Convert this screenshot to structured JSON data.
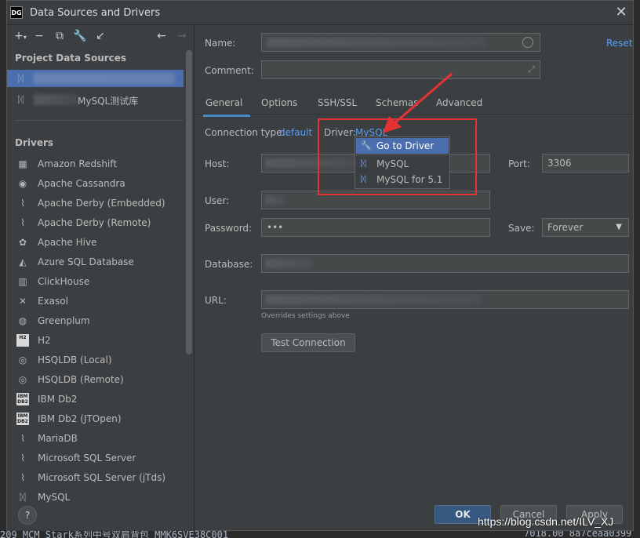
{
  "window": {
    "title": "Data Sources and Drivers",
    "app_icon_text": "DG"
  },
  "left": {
    "project_title": "Project Data Sources",
    "project_items": [
      {
        "label": ""
      },
      {
        "label": "MySQL测试库"
      }
    ],
    "drivers_title": "Drivers",
    "drivers": [
      {
        "label": "Amazon Redshift",
        "icon": "redshift-icon"
      },
      {
        "label": "Apache Cassandra",
        "icon": "cassandra-icon"
      },
      {
        "label": "Apache Derby (Embedded)",
        "icon": "derby-icon"
      },
      {
        "label": "Apache Derby (Remote)",
        "icon": "derby-icon"
      },
      {
        "label": "Apache Hive",
        "icon": "hive-icon"
      },
      {
        "label": "Azure SQL Database",
        "icon": "azure-icon"
      },
      {
        "label": "ClickHouse",
        "icon": "clickhouse-icon"
      },
      {
        "label": "Exasol",
        "icon": "exasol-icon"
      },
      {
        "label": "Greenplum",
        "icon": "greenplum-icon"
      },
      {
        "label": "H2",
        "icon": "h2-icon",
        "badge": "H2"
      },
      {
        "label": "HSQLDB (Local)",
        "icon": "hsqldb-icon"
      },
      {
        "label": "HSQLDB (Remote)",
        "icon": "hsqldb-icon"
      },
      {
        "label": "IBM Db2",
        "icon": "ibm-db2-icon",
        "badge": "IBM DB2"
      },
      {
        "label": "IBM Db2 (JTOpen)",
        "icon": "ibm-db2-icon",
        "badge": "IBM DB2"
      },
      {
        "label": "MariaDB",
        "icon": "mariadb-icon"
      },
      {
        "label": "Microsoft SQL Server",
        "icon": "mssql-icon"
      },
      {
        "label": "Microsoft SQL Server (jTds)",
        "icon": "mssql-icon"
      },
      {
        "label": "MySQL",
        "icon": "mysql-icon"
      }
    ],
    "help_label": "?"
  },
  "form": {
    "name_label": "Name:",
    "name_value": "",
    "reset_label": "Reset",
    "comment_label": "Comment:",
    "comment_value": "",
    "tabs": [
      "General",
      "Options",
      "SSH/SSL",
      "Schemas",
      "Advanced"
    ],
    "active_tab": "General",
    "connection_type_label": "Connection type:",
    "connection_type_value": "default",
    "driver_label": "Driver:",
    "driver_value": "MySQL",
    "host_label": "Host:",
    "host_value": "",
    "port_label": "Port:",
    "port_value": "3306",
    "user_label": "User:",
    "user_value": "",
    "password_label": "Password:",
    "password_value": "•••",
    "save_label": "Save:",
    "save_value": "Forever",
    "database_label": "Database:",
    "database_value": "",
    "url_label": "URL:",
    "url_value": "",
    "url_hint": "Overrides settings above",
    "test_connection_label": "Test Connection"
  },
  "driver_popup": {
    "items": [
      {
        "label": "Go to Driver",
        "icon": "wrench-icon"
      },
      {
        "label": "MySQL",
        "icon": "mysql-icon"
      },
      {
        "label": "MySQL for 5.1",
        "icon": "mysql-icon"
      }
    ]
  },
  "buttons": {
    "ok": "OK",
    "cancel": "Cancel",
    "apply": "Apply"
  },
  "background": {
    "bottom_text": "209  MCM Stark系列中号双肩背包 MMK6SVE38C001",
    "bottom_right": "7018.00  8a7ceaa0399"
  },
  "overlay": {
    "watermark": "https://blog.csdn.net/ILV_XJ",
    "annotation_color": "#e53232"
  },
  "colors": {
    "accent": "#4b6eaf",
    "link": "#589df6",
    "dialog_bg": "#3c3f41"
  }
}
